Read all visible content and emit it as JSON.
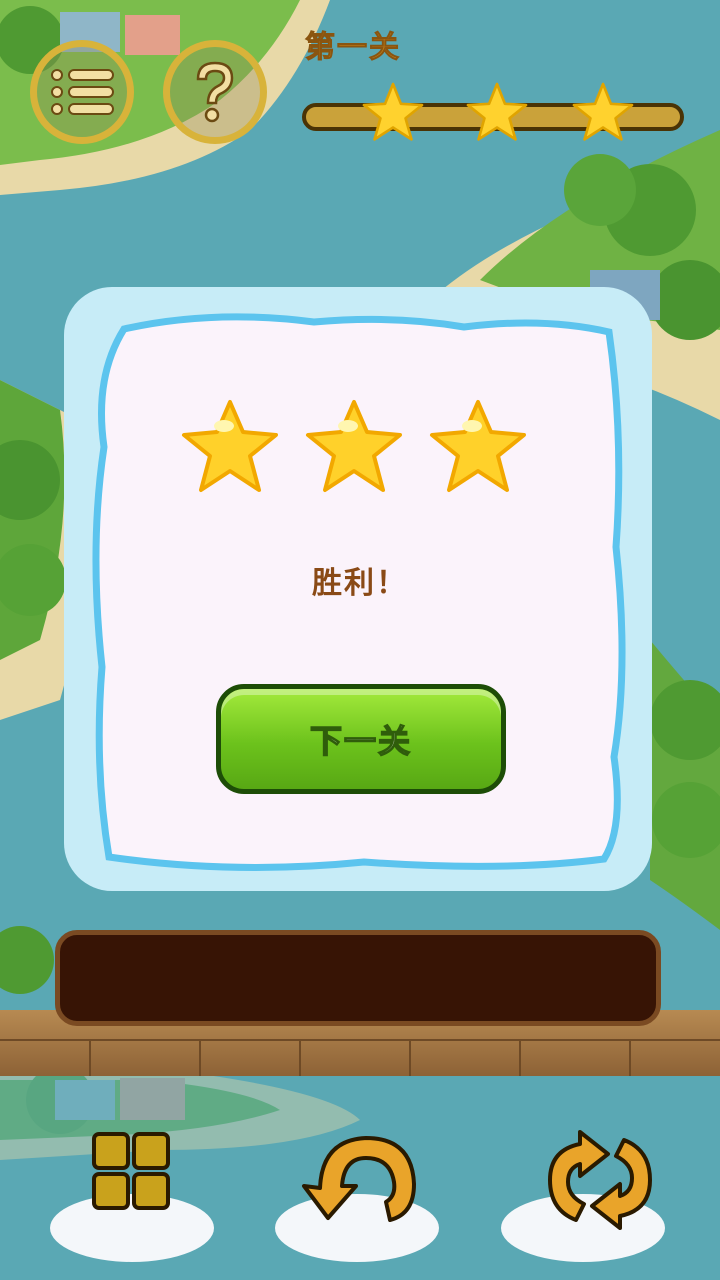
{
  "level": {
    "title": "第一关",
    "stars_earned": 3,
    "stars_total": 3
  },
  "toolbar": {
    "menu_icon": "list-icon",
    "help_icon": "question-icon"
  },
  "dialog": {
    "message": "胜利！",
    "next_button_label": "下一关",
    "stars": 3
  },
  "bottom_tools": [
    "grid-icon",
    "undo-icon",
    "shuffle-icon"
  ],
  "colors": {
    "accent_gold": "#d8b33a",
    "button_green": "#6cc21c",
    "text_brown": "#8a4a16",
    "tray_brown": "#371405"
  }
}
